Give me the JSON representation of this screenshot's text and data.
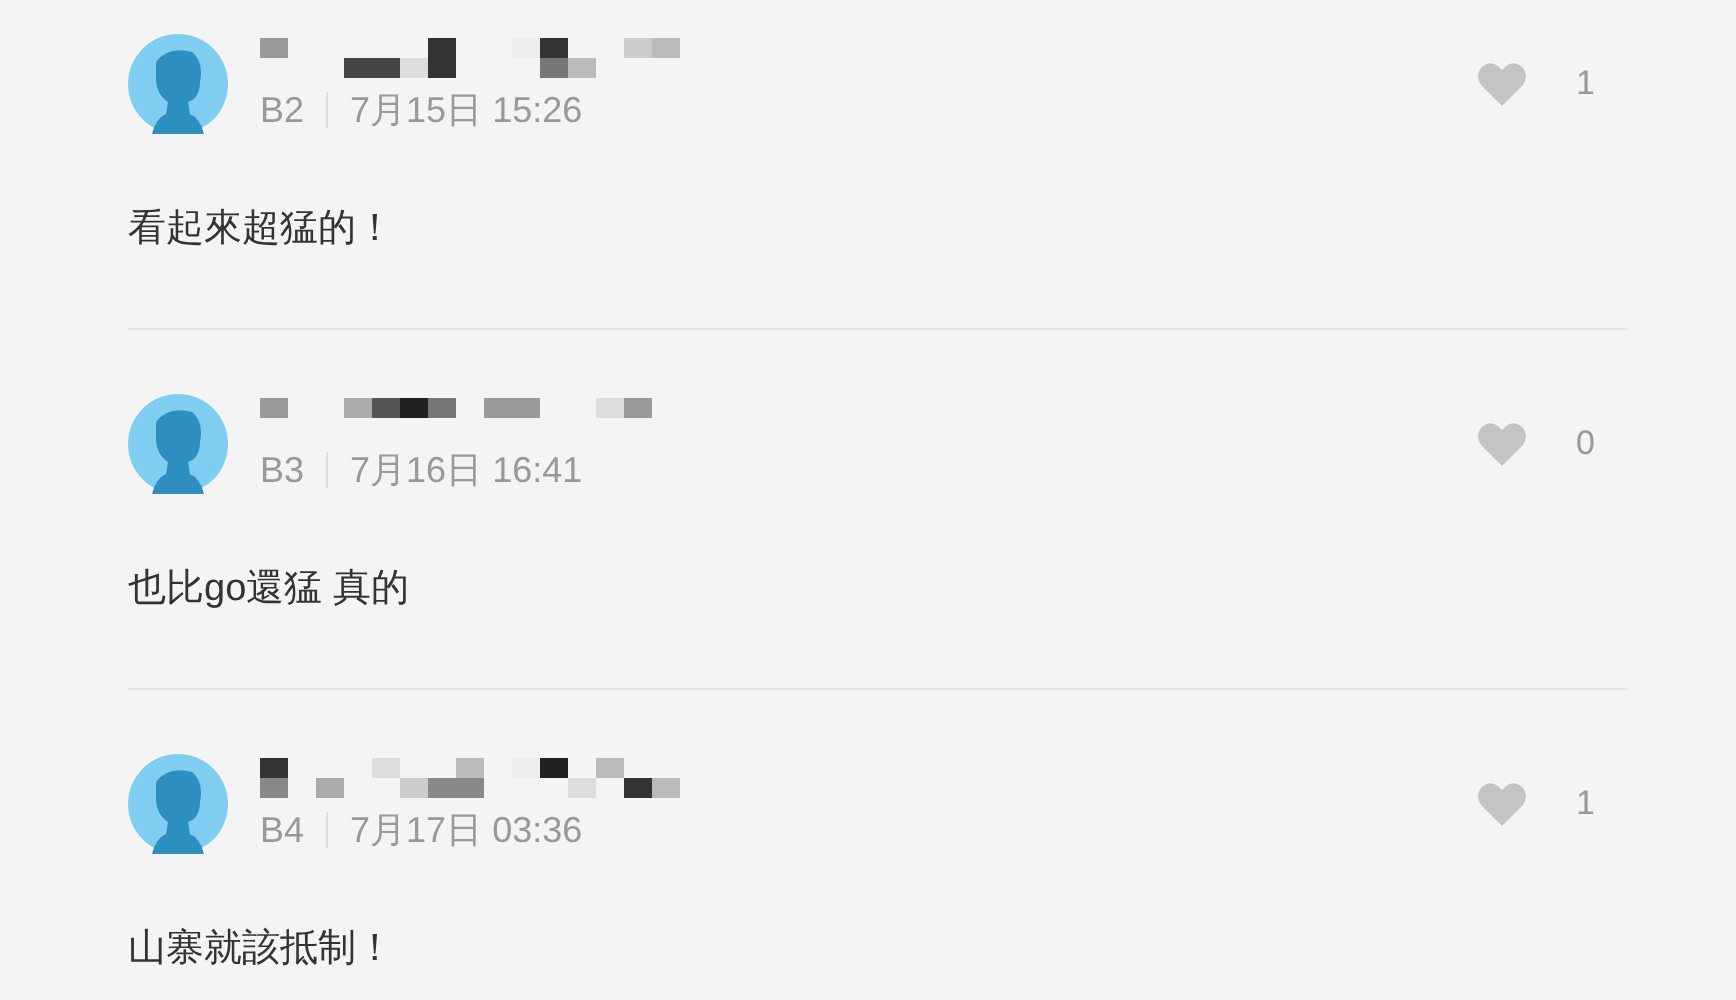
{
  "comments": [
    {
      "floor": "B2",
      "time": "7月15日 15:26",
      "text": "看起來超猛的！",
      "likes": "1"
    },
    {
      "floor": "B3",
      "time": "7月16日 16:41",
      "text": "也比go還猛 真的",
      "likes": "0"
    },
    {
      "floor": "B4",
      "time": "7月17日 03:36",
      "text": "山寨就該抵制！",
      "likes": "1"
    }
  ]
}
